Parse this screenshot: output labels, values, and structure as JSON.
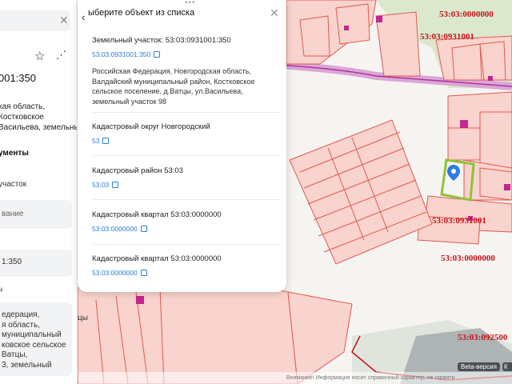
{
  "popup": {
    "title": "ыберите объект из списка",
    "items": [
      {
        "title": "Земельный участок: 53:03:0931001:350",
        "link": "53:03:0931001:350",
        "desc": "Российская Федерация, Новгородская область, Валдайский муниципальный район, Костковское сельское поселение, д.Ватцы, ул.Васильева, земельный участок 98"
      },
      {
        "title": "Кадастровый округ Новгородский",
        "link": "53"
      },
      {
        "title": "Кадастровый район 53:03",
        "link": "53:03"
      },
      {
        "title": "Кадастровый квартал 53:03:0000000",
        "link": "53:03:0000000"
      },
      {
        "title": "Кадастровый квартал 53:03:0000000",
        "link": "53:03:0000000"
      }
    ]
  },
  "left_card": {
    "number_suffix": "001:350",
    "address_lines": [
      "кая область,",
      "Костковское",
      "Васильева, земельный"
    ],
    "section_title": "ументы",
    "row1": "участок",
    "row2": "вание",
    "row3": "1:350",
    "row4": "ч",
    "address2_lines": [
      "едерация,",
      "я область,",
      "муниципальный",
      "ковское сельское",
      "Ватцы,",
      "3, земельный"
    ]
  },
  "map_labels": {
    "top_right": "53:03:0000000",
    "upper": "53:03:0931001",
    "mid": "53:03:0931001",
    "mid2": "53:03:0000000",
    "bottom": "53:03:092500",
    "street": "цы"
  },
  "badges": {
    "beta": "Beta-версия",
    "beta2": "К"
  },
  "disclaimer": "Внимание! Информация носит справочный характер, не гаранти"
}
